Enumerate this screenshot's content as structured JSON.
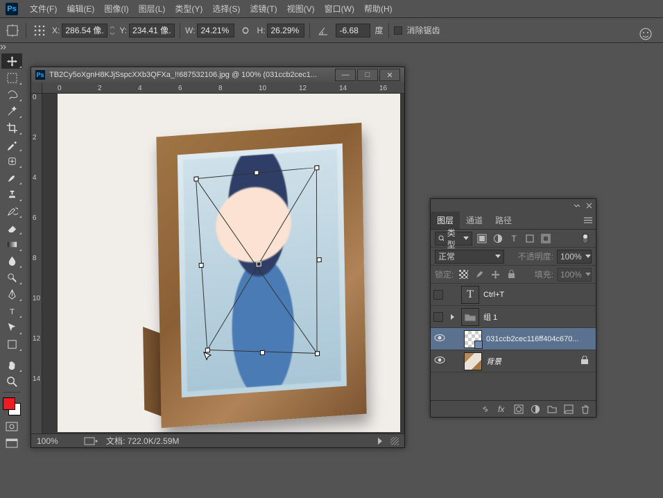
{
  "menu": {
    "items": [
      "文件(F)",
      "编辑(E)",
      "图像(I)",
      "图层(L)",
      "类型(Y)",
      "选择(S)",
      "滤镜(T)",
      "视图(V)",
      "窗口(W)",
      "帮助(H)"
    ]
  },
  "options": {
    "x_label": "X:",
    "x": "286.54 像...",
    "y_label": "Y:",
    "y": "234.41 像...",
    "w_label": "W:",
    "w": "24.21%",
    "h_label": "H:",
    "h": "26.29%",
    "angle": "-6.68",
    "angle_unit": "度",
    "antialias": "消除锯齿"
  },
  "doc": {
    "title": "TB2Cy5oXgnH8KJjSspcXXb3QFXa_!!687532106.jpg @ 100% (031ccb2cec1...",
    "ruler_h": [
      "0",
      "2",
      "4",
      "6",
      "8",
      "10",
      "12",
      "14",
      "16"
    ],
    "ruler_v": [
      "0",
      "2",
      "4",
      "6",
      "8",
      "10",
      "12",
      "14"
    ],
    "zoom": "100%",
    "status": "文档: 722.0K/2.59M"
  },
  "panel": {
    "tabs": [
      "图层",
      "通道",
      "路径"
    ],
    "kind_label": "类型",
    "blend": "正常",
    "opacity_label": "不透明度:",
    "opacity": "100%",
    "lock_label": "锁定:",
    "fill_label": "填充:",
    "fill": "100%",
    "layers": [
      {
        "eye": false,
        "type": "T",
        "name": "Ctrl+T"
      },
      {
        "eye": false,
        "type": "group",
        "name": "组 1",
        "collapsed": true
      },
      {
        "eye": true,
        "type": "smart",
        "name": "031ccb2cec116ff404c670...",
        "selected": true
      },
      {
        "eye": true,
        "type": "bg",
        "name": "背景",
        "locked": true
      }
    ]
  }
}
